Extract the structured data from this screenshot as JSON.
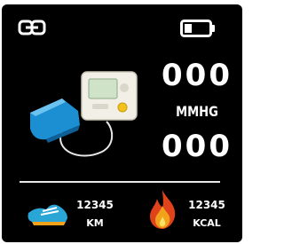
{
  "status_bar": {
    "connection_icon": "link-icon",
    "battery_icon": "battery-icon"
  },
  "blood_pressure": {
    "illustration_icon": "blood-pressure-monitor-icon",
    "systolic": "000",
    "unit": "MMHG",
    "diastolic": "000"
  },
  "activity": {
    "distance": {
      "icon": "shoe-icon",
      "value": "12345",
      "unit": "KM"
    },
    "calories": {
      "icon": "flame-icon",
      "value": "12345",
      "unit": "KCAL"
    }
  },
  "colors": {
    "background": "#000000",
    "text": "#ffffff",
    "cuff_blue": "#1b8fd1",
    "flame_orange": "#f2a11b"
  }
}
